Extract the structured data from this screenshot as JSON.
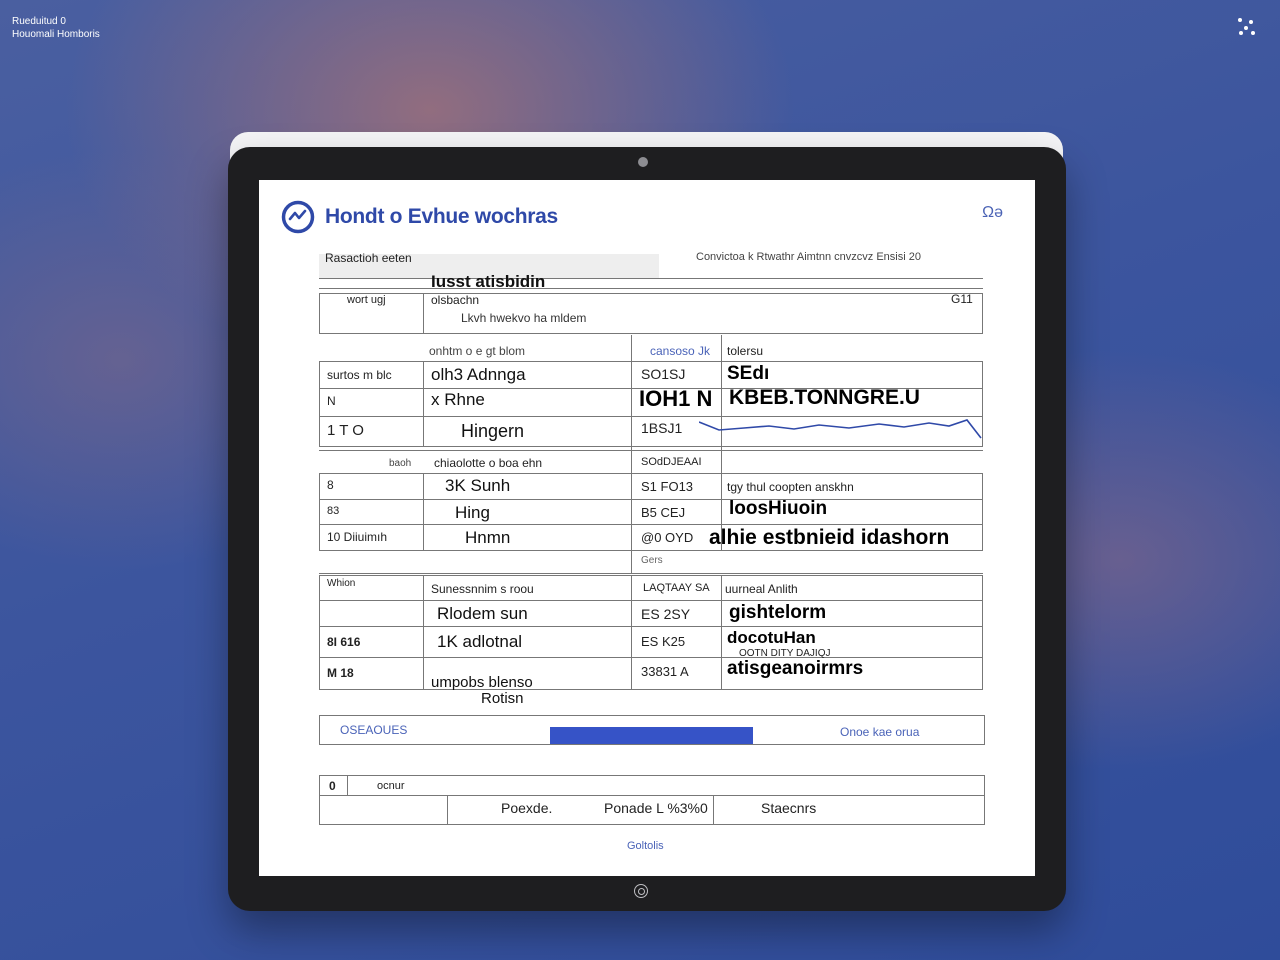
{
  "desktop": {
    "corner_line1": "Rueduitud 0",
    "corner_line2": "Houomali Homboris"
  },
  "app": {
    "title": "Hondt o Evhue wochras",
    "header_icon": "Ωə",
    "subheader_left": "Rasactioh eeten",
    "subheader_right": "Convictoa k Rtwathr Aimtnn cnvzcvz Ensisi 20"
  },
  "top_block": {
    "label": "Iusst atisbidin",
    "left_cell": "wort ugj",
    "line2": "olsbachn",
    "line3": "Lkvh hwekvo ha mldem",
    "right_value": "G11"
  },
  "table1": {
    "headers": [
      "onhtm o e gt blom",
      "cansoso Jk",
      "tolersu"
    ],
    "rows": [
      {
        "a": "surtos m blc",
        "b": "olh3 Adnnga",
        "c": "SO1SJ",
        "d": "SEdı"
      },
      {
        "a": "N",
        "b": "x Rhne",
        "c": "IOH1 N",
        "d": "KBEB.TONNGRE.U"
      },
      {
        "a": "1  T  O",
        "b": "Hingern",
        "c": "1BSJ1",
        "d": ""
      }
    ]
  },
  "table2": {
    "headers": [
      "baoh",
      "chiaolotte o boa ehn",
      "SOdDJEAAI"
    ],
    "rows": [
      {
        "a": "8",
        "b": "3K Sunh",
        "c": "S1 FO13",
        "d": "tgy thul coopten anskhn"
      },
      {
        "a": "83",
        "b": "Hing",
        "c": "B5 CEJ",
        "d": "loosHiuoin"
      },
      {
        "a": "10 Diiuimıh",
        "b": "Hnmn",
        "c": "@0 OYD",
        "d": "alhie estbnieid idashorn"
      }
    ],
    "footer": "Gers"
  },
  "table3": {
    "headers": [
      "Whion",
      "Sunessnnim s roou",
      "LAQTAAY SA",
      "uurneal Anlith"
    ],
    "rows": [
      {
        "a": "",
        "b": "Rlodem sun",
        "c": "ES 2SY",
        "d": "gishtelorm"
      },
      {
        "a": "8I  616",
        "b": "1K adlotnal",
        "c": "ES K25",
        "d": "docotuHan"
      },
      {
        "a": "M  18",
        "b": "umpobs blenso",
        "c": "33831  A",
        "d": "atisgeanoirmrs"
      }
    ],
    "footnote": "Rotisn",
    "overlay": "OOTN DITY DAJIQJ"
  },
  "action_bar": {
    "left": "OSEAOUES",
    "right": "Onoe  kae orua"
  },
  "summary": {
    "index": "0",
    "header": "ocnur",
    "col1": "Poexde.",
    "col2": "Ponade L %3%0",
    "col3": "Staecnrs"
  },
  "footer_link": "Goltolis",
  "colors": {
    "accent": "#2f49a8",
    "bar": "#3653c7",
    "bezel": "#1e1e20"
  }
}
